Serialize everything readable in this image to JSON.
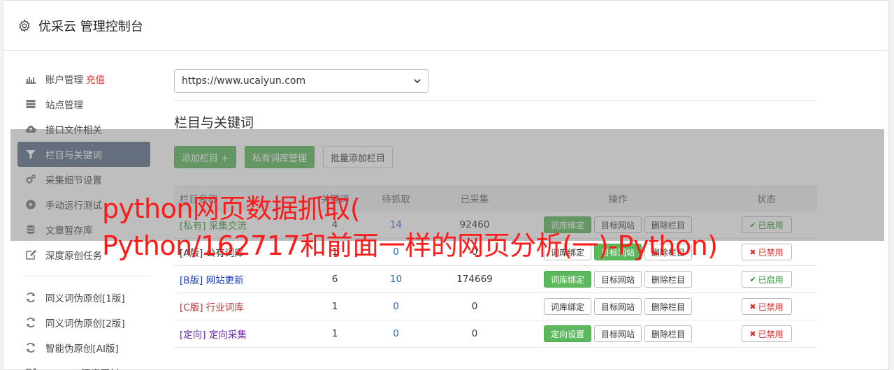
{
  "header": {
    "title": "优采云 管理控制台"
  },
  "sidebar": {
    "items": [
      {
        "label": "账户管理",
        "extra": "充值",
        "icon": "bar-chart-icon"
      },
      {
        "label": "站点管理",
        "icon": "server-icon"
      },
      {
        "label": "接口文件相关",
        "icon": "cloud-upload-icon"
      },
      {
        "label": "栏目与关键词",
        "icon": "filter-icon",
        "active": true
      },
      {
        "label": "采集细节设置",
        "icon": "cogs-icon"
      },
      {
        "label": "手动运行测试",
        "icon": "play-circle-icon"
      },
      {
        "label": "文章暂存库",
        "icon": "database-icon"
      },
      {
        "label": "深度原创任务",
        "icon": "edit-icon"
      }
    ],
    "items2": [
      {
        "label": "同义词伪原创[1版]",
        "icon": "refresh-icon"
      },
      {
        "label": "同义词伪原创[2版]",
        "icon": "refresh-icon"
      },
      {
        "label": "智能伪原创[AI版]",
        "icon": "refresh-icon"
      },
      {
        "label": "UWriter深度原创",
        "icon": "edit-icon"
      }
    ]
  },
  "site_select": {
    "value": "https://www.ucaiyun.com"
  },
  "section": {
    "title": "栏目与关键词"
  },
  "toolbar": {
    "add_column": "添加栏目 +",
    "private_lib": "私有词库管理",
    "batch_add": "批量添加栏目"
  },
  "table": {
    "headers": {
      "name": "栏目名称",
      "n1": "关键词",
      "n2": "待抓取",
      "n3": "已采集",
      "ops": "操作",
      "status": "状态"
    },
    "rows": [
      {
        "tag": "[私有]",
        "name": "采集交流",
        "color": "#3c9a3c",
        "n1": "4",
        "n2": "14",
        "n3": "92460",
        "op1": "词库绑定",
        "op1_green": true,
        "op2": "目标网站",
        "op3": "删除栏目",
        "status": "已启用",
        "enabled": true
      },
      {
        "tag": "[A版]",
        "name": "公有词库",
        "color": "#333333",
        "n1": "1",
        "n2": "0",
        "n3": "0",
        "op1": "词库绑定",
        "op1_green": false,
        "op2": "目标网站",
        "op2_green": true,
        "op3": "删除栏目",
        "status": "已禁用",
        "enabled": false
      },
      {
        "tag": "[B版]",
        "name": "网站更新",
        "color": "#1a3fbf",
        "n1": "6",
        "n2": "10",
        "n3": "174669",
        "op1": "词库绑定",
        "op1_green": true,
        "op2": "目标网站",
        "op3": "删除栏目",
        "status": "已启用",
        "enabled": true
      },
      {
        "tag": "[C版]",
        "name": "行业词库",
        "color": "#b43c3c",
        "n1": "1",
        "n2": "0",
        "n3": "0",
        "op1": "词库绑定",
        "op1_green": false,
        "op2": "目标网站",
        "op3": "删除栏目",
        "status": "已禁用",
        "enabled": false
      },
      {
        "tag": "[定向]",
        "name": "定向采集",
        "color": "#6a2aa8",
        "n1": "1",
        "n2": "0",
        "n3": "0",
        "op1": "定向设置",
        "op1_green": true,
        "op2": "目标网站",
        "op3": "删除栏目",
        "status": "已禁用",
        "enabled": false
      }
    ]
  },
  "watermark": {
    "line1": "python网页数据抓取(",
    "line2": "Python/162717和前面一样的网页分析(一)-Python)"
  }
}
